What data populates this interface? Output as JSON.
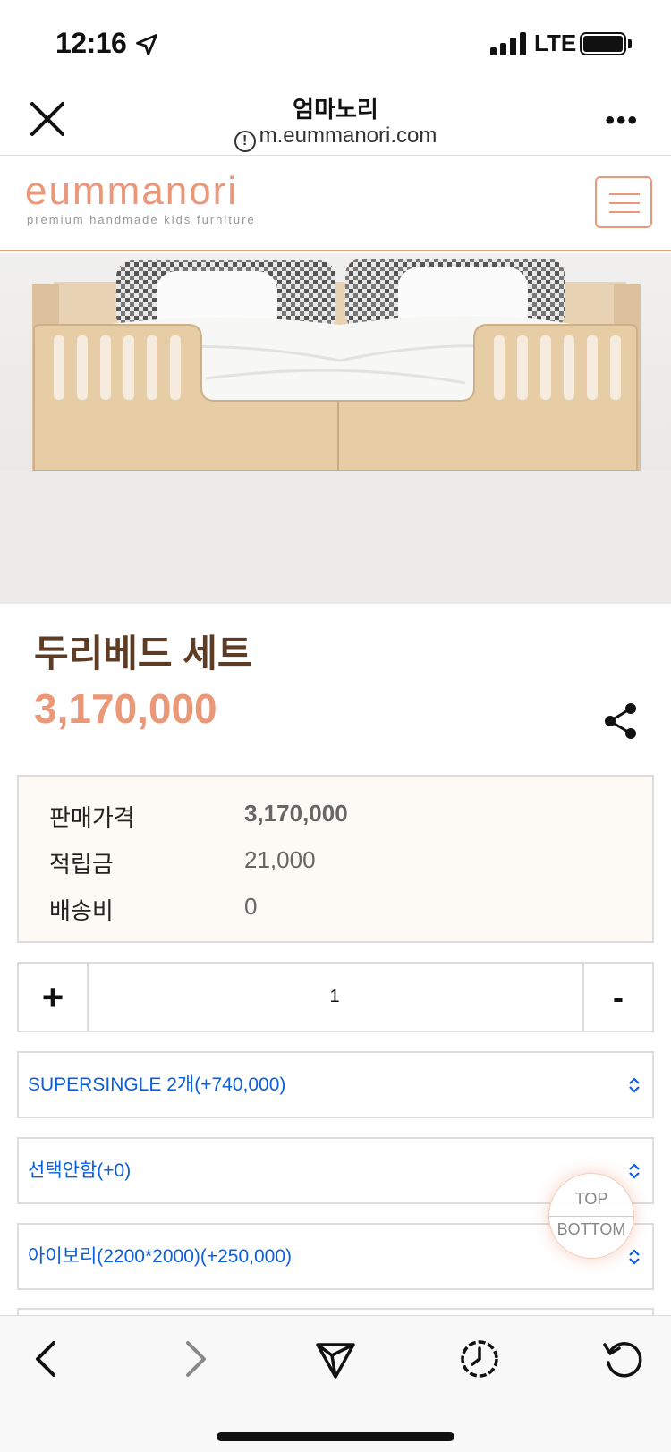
{
  "status_bar": {
    "time": "12:16",
    "network": "LTE"
  },
  "browser": {
    "title": "엄마노리",
    "url": "m.eummanori.com"
  },
  "site": {
    "logo": "eummanori",
    "tagline": "premium handmade kids furniture",
    "accent": "#ea9878"
  },
  "product": {
    "name": "두리베드 세트",
    "price": "3,170,000"
  },
  "info": [
    {
      "label": "판매가격",
      "value": "3,170,000"
    },
    {
      "label": "적립금",
      "value": "21,000"
    },
    {
      "label": "배송비",
      "value": "0"
    }
  ],
  "quantity": {
    "plus": "+",
    "value": "1",
    "minus": "-"
  },
  "options": [
    "SUPERSINGLE 2개(+740,000)",
    "선택안함(+0)",
    "아이보리(2200*2000)(+250,000)"
  ],
  "scroll_buttons": {
    "top": "TOP",
    "bottom": "BOTTOM"
  },
  "icons": [
    "location-arrow-icon",
    "close-icon",
    "info-icon",
    "more-icon",
    "menu-icon",
    "share-icon",
    "back-icon",
    "forward-icon",
    "send-icon",
    "history-icon",
    "reload-icon"
  ]
}
